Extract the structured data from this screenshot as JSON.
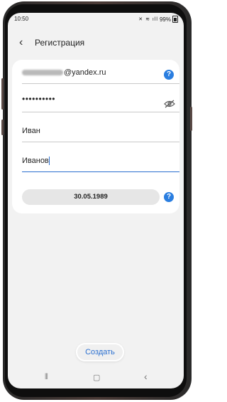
{
  "status_bar": {
    "time": "10:50",
    "icons": "✕ ≋ ıll",
    "battery_percent": "99%"
  },
  "header": {
    "back_icon": "‹",
    "title": "Регистрация"
  },
  "form": {
    "email_suffix": "@yandex.ru",
    "password_mask": "••••••••••",
    "first_name": "Иван",
    "last_name": "Иванов",
    "birth_date": "30.05.1989",
    "help_symbol": "?"
  },
  "actions": {
    "create_label": "Создать"
  },
  "nav": {
    "recent_symbol": "⦀",
    "home_symbol": "▢",
    "back_symbol": "‹"
  },
  "colors": {
    "accent": "#2a6fd0",
    "help": "#2a7ee0",
    "screen_bg": "#f2f2f2",
    "phone_frame": "#8a6a62"
  }
}
